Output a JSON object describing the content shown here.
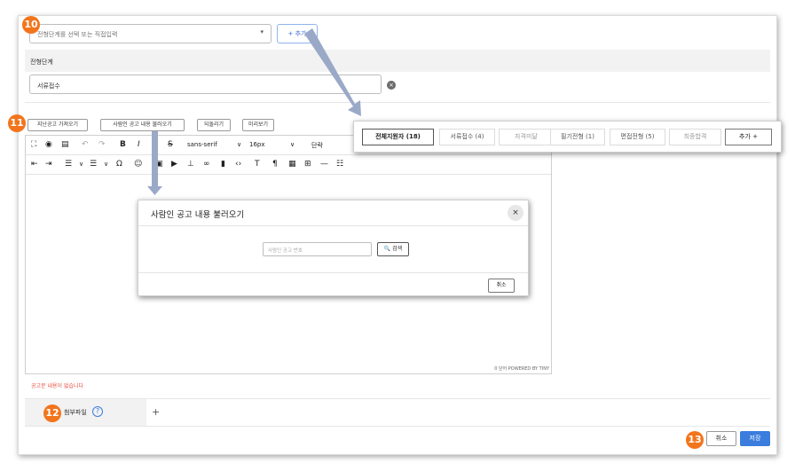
{
  "stage_select": {
    "placeholder": "전형단계를 선택 또는 직접입력",
    "caret": "▾"
  },
  "add_stage_button": "+ 추가",
  "stage_section": {
    "title": "전형단계",
    "value": "서류접수"
  },
  "editor_buttons": {
    "prev_posting": "지난공고 가져오기",
    "saramin_posting": "사람인 공고 내용 불러오기",
    "revert": "되돌리기",
    "preview": "미리보기"
  },
  "editor": {
    "font": "sans-serif",
    "font_size": "16px",
    "block_format": "단락",
    "footer": "0 단어  POWERED BY TINY"
  },
  "error_message": "공고문 내용이 없습니다",
  "attachment": {
    "label": "첨부파일",
    "help": "?",
    "add": "+"
  },
  "actions": {
    "cancel": "취소",
    "save": "저장"
  },
  "badges": [
    "10",
    "11",
    "12",
    "13"
  ],
  "tabs_popup": {
    "tabs": [
      {
        "label": "전체지원자 (18)",
        "state": "active"
      },
      {
        "label": "서류접수 (4)",
        "state": "normal"
      },
      {
        "label": "자격미달",
        "state": "muted"
      },
      {
        "label": "필기전형 (1)",
        "state": "normal"
      },
      {
        "label": "면접전형 (5)",
        "state": "normal"
      },
      {
        "label": "최종합격",
        "state": "muted"
      }
    ],
    "add_label": "추가 +"
  },
  "modal": {
    "title": "사람인 공고 내용 불러오기",
    "close": "×",
    "input_placeholder": "사람인 공고 번호",
    "search_label": "🔍 검색",
    "cancel_label": "취소"
  },
  "colors": {
    "accent": "#3b7ddd",
    "badge": "#f2751c",
    "error": "#e74c3c",
    "arrow": "#9aa9c8"
  }
}
